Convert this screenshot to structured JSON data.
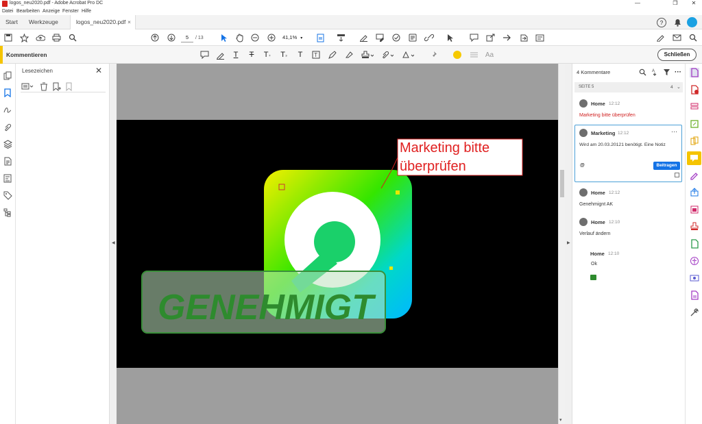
{
  "window": {
    "title": "logos_neu2020.pdf - Adobe Acrobat Pro DC",
    "controls": {
      "minimize": "—",
      "maximize": "❐",
      "close": "✕"
    }
  },
  "menu": [
    "Datei",
    "Bearbeiten",
    "Anzeige",
    "Fenster",
    "Hilfe"
  ],
  "tabs": {
    "start": "Start",
    "tools": "Werkzeuge",
    "document": "logos_neu2020.pdf",
    "close": "×"
  },
  "toolbar": {
    "page_current": "5",
    "page_total": "/ 13",
    "zoom": "41,1%"
  },
  "comment_bar": {
    "title": "Kommentieren",
    "close_label": "Schließen",
    "text_size_label": "Aa",
    "accent_color": "#f5c400",
    "highlight_color": "#f6c900"
  },
  "bookmarks": {
    "title": "Lesezeichen",
    "close": "✕"
  },
  "document": {
    "callout_text_line1": "Marketing bitte",
    "callout_text_line2": "überprüfen",
    "stamp_text": "GENEHMIGT",
    "stamp_color": "#2e8b2e",
    "callout_color": "#e02020"
  },
  "comments_panel": {
    "count_label": "4 Kommentare",
    "page_label": "SEITE 5",
    "page_count": "4",
    "comments": [
      {
        "author": "Home",
        "time": "12:12",
        "text": "Marketing bitte überprüfen"
      },
      {
        "author": "Marketing",
        "time": "12:12",
        "text": "Wird am 20.03.20121 benötigt. Eine Notiz",
        "mention": "@",
        "post_label": "Beitragen"
      },
      {
        "author": "Home",
        "time": "12:12",
        "text": "Genehmignt AK"
      },
      {
        "author": "Home",
        "time": "12:10",
        "text": "Verlauf ändern"
      },
      {
        "author": "Home",
        "time": "12:10",
        "text": "Ok"
      }
    ]
  }
}
